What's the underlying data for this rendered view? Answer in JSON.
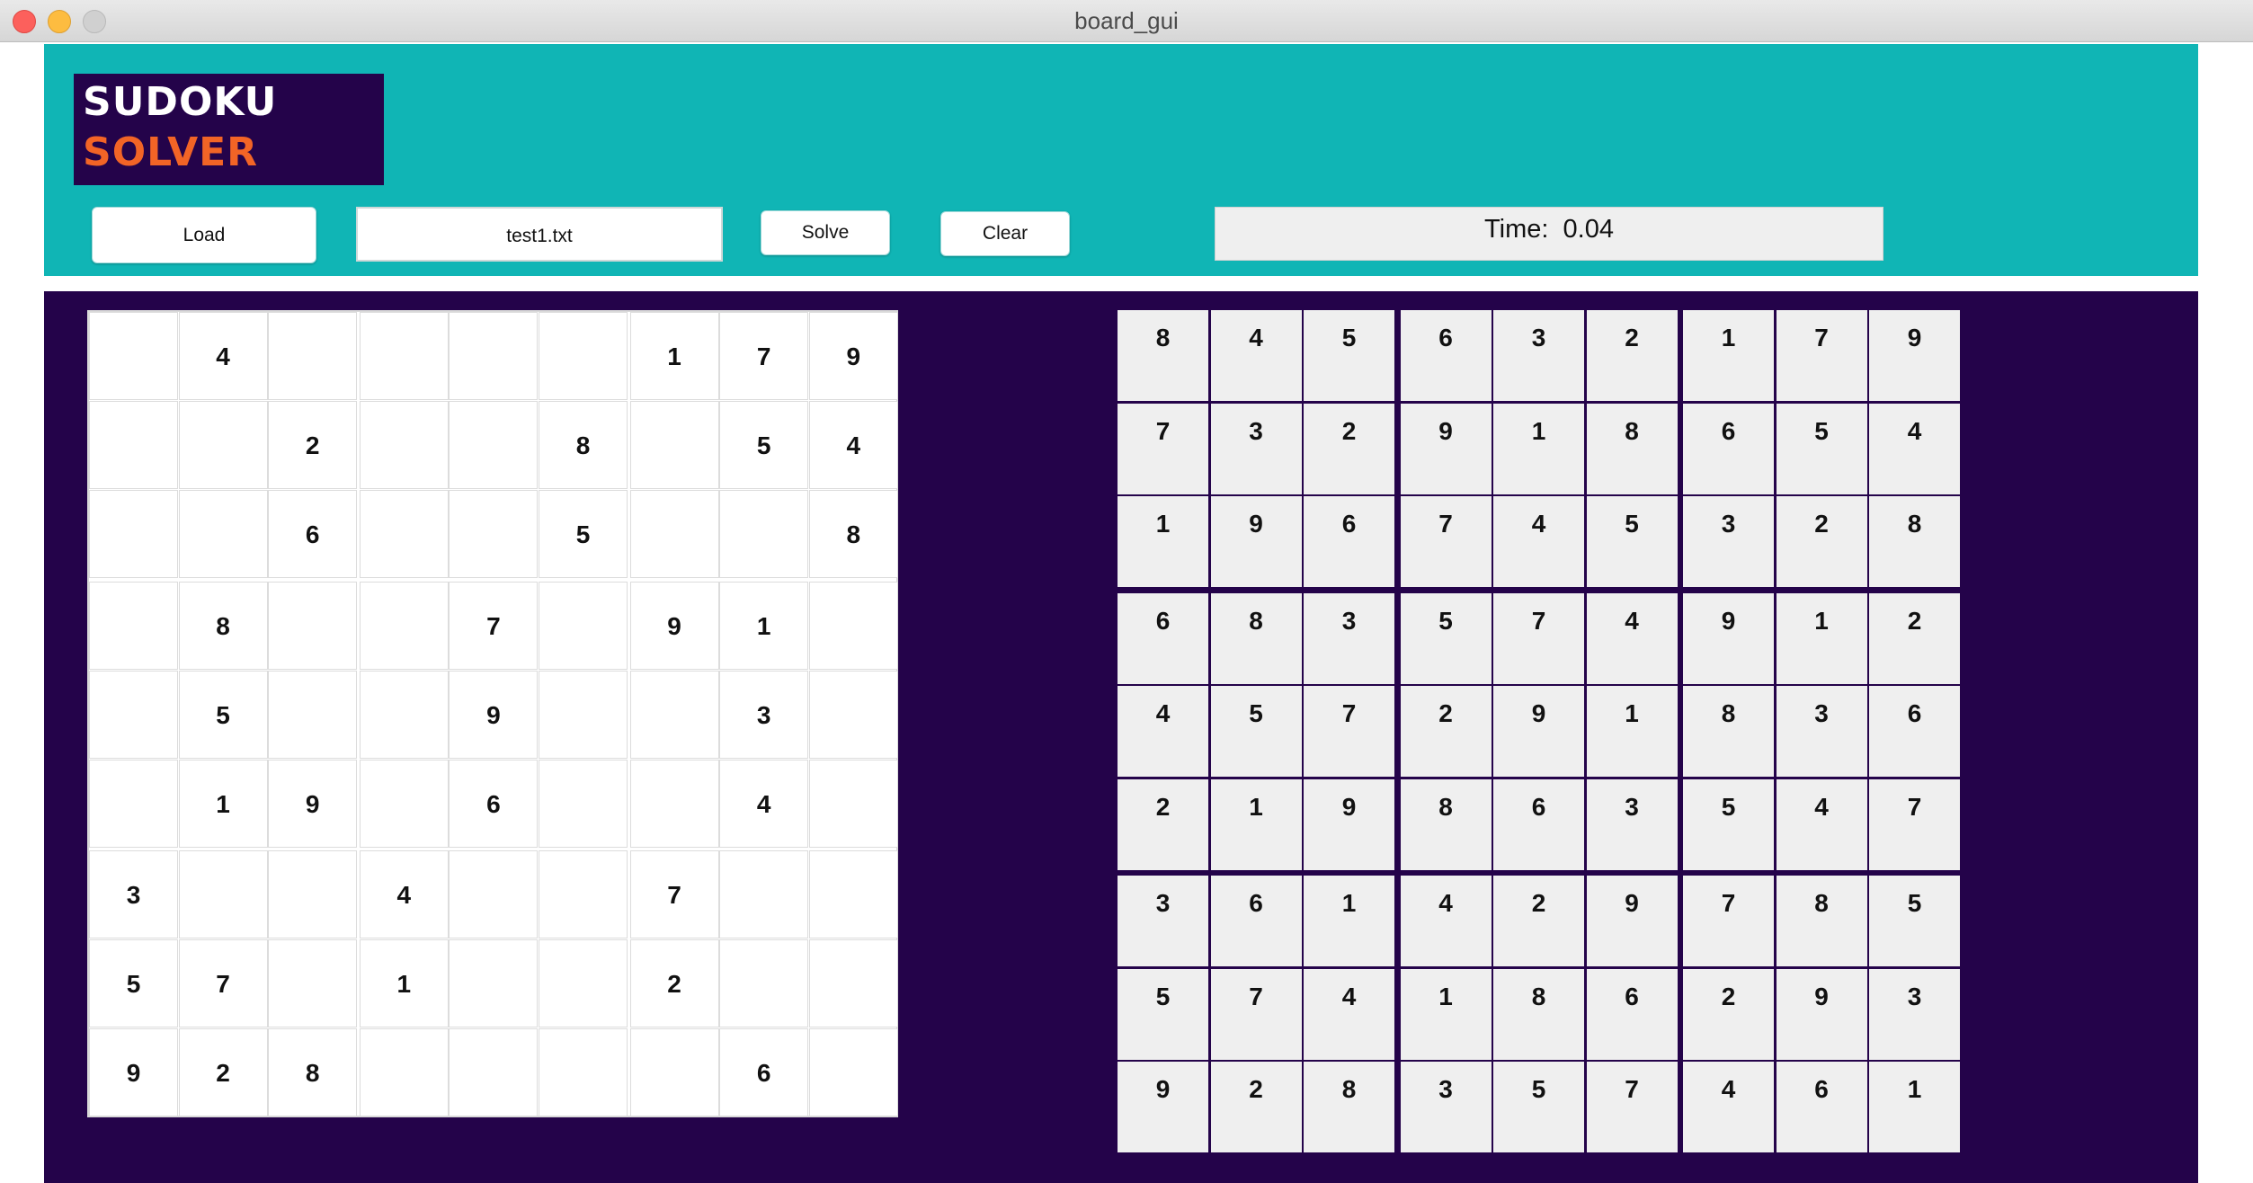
{
  "window": {
    "title": "board_gui"
  },
  "logo": {
    "line1": "SUDOKU",
    "line2": "SOLVER"
  },
  "toolbar": {
    "load_label": "Load",
    "file_value": "test1.txt",
    "solve_label": "Solve",
    "clear_label": "Clear",
    "time_label": "Time:",
    "time_value": "0.04"
  },
  "colors": {
    "header": "#10b5b5",
    "board_background": "#24034a",
    "logo_accent": "#f26426"
  },
  "puzzle": [
    [
      "",
      "4",
      "",
      "",
      "",
      "",
      "1",
      "7",
      "9"
    ],
    [
      "",
      "",
      "2",
      "",
      "",
      "8",
      "",
      "5",
      "4"
    ],
    [
      "",
      "",
      "6",
      "",
      "",
      "5",
      "",
      "",
      "8"
    ],
    [
      "",
      "8",
      "",
      "",
      "7",
      "",
      "9",
      "1",
      ""
    ],
    [
      "",
      "5",
      "",
      "",
      "9",
      "",
      "",
      "3",
      ""
    ],
    [
      "",
      "1",
      "9",
      "",
      "6",
      "",
      "",
      "4",
      ""
    ],
    [
      "3",
      "",
      "",
      "4",
      "",
      "",
      "7",
      "",
      ""
    ],
    [
      "5",
      "7",
      "",
      "1",
      "",
      "",
      "2",
      "",
      ""
    ],
    [
      "9",
      "2",
      "8",
      "",
      "",
      "",
      "",
      "6",
      ""
    ]
  ],
  "solution": [
    [
      "8",
      "4",
      "5",
      "6",
      "3",
      "2",
      "1",
      "7",
      "9"
    ],
    [
      "7",
      "3",
      "2",
      "9",
      "1",
      "8",
      "6",
      "5",
      "4"
    ],
    [
      "1",
      "9",
      "6",
      "7",
      "4",
      "5",
      "3",
      "2",
      "8"
    ],
    [
      "6",
      "8",
      "3",
      "5",
      "7",
      "4",
      "9",
      "1",
      "2"
    ],
    [
      "4",
      "5",
      "7",
      "2",
      "9",
      "1",
      "8",
      "3",
      "6"
    ],
    [
      "2",
      "1",
      "9",
      "8",
      "6",
      "3",
      "5",
      "4",
      "7"
    ],
    [
      "3",
      "6",
      "1",
      "4",
      "2",
      "9",
      "7",
      "8",
      "5"
    ],
    [
      "5",
      "7",
      "4",
      "1",
      "8",
      "6",
      "2",
      "9",
      "3"
    ],
    [
      "9",
      "2",
      "8",
      "3",
      "5",
      "7",
      "4",
      "6",
      "1"
    ]
  ]
}
